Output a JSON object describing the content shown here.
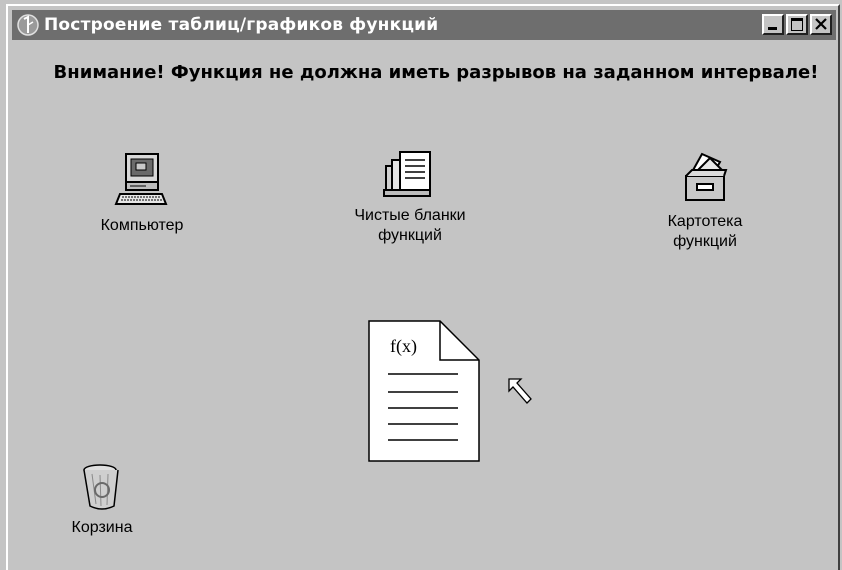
{
  "window": {
    "title": "Построение таблиц/графиков функций",
    "title_icon": "app-icon",
    "buttons": [
      "minimize-icon",
      "maximize-icon",
      "close-icon"
    ]
  },
  "warning_text": "Внимание! Функция не должна иметь разрывов на заданном интервале!",
  "icons": {
    "computer": {
      "label": "Компьютер",
      "icon": "computer-icon"
    },
    "blank_forms": {
      "label_line1": "Чистые бланки",
      "label_line2": "функций",
      "icon": "blank-forms-icon"
    },
    "card_index": {
      "label_line1": "Картотека",
      "label_line2": "функций",
      "icon": "card-index-icon"
    },
    "trash": {
      "label": "Корзина",
      "icon": "recycle-bin-icon"
    }
  },
  "document": {
    "label": "f(x)",
    "icon": "function-document-icon"
  },
  "colors": {
    "background": "#c4c4c4",
    "titlebar": "#6e6e6e",
    "title_text": "#ffffff"
  }
}
